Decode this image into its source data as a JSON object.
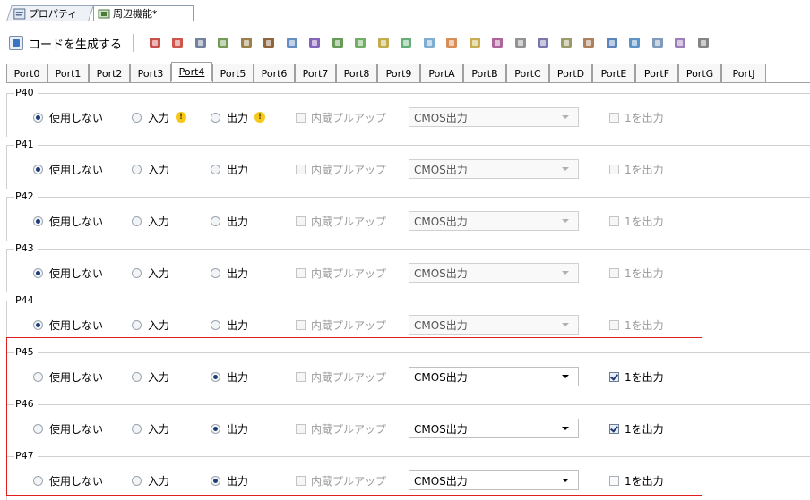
{
  "doc_tabs": [
    {
      "label": "プロパティ",
      "icon": "properties-icon"
    },
    {
      "label": "周辺機能*",
      "icon": "peripheral-icon"
    }
  ],
  "toolbar": {
    "generate_label": "コードを生成する",
    "icons": [
      "clock-gen-icon",
      "reset-icon",
      "ocd-icon",
      "voltage-icon",
      "flash-icon",
      "chip-icon",
      "watchdog-icon",
      "lvd-icon",
      "port-icon",
      "interrupt-icon",
      "timer-icon",
      "timer2-icon",
      "timer3-icon",
      "timer4-icon",
      "rtc-icon",
      "wdt-icon",
      "clock-out-icon",
      "pcl-icon",
      "serial-icon",
      "serial2-icon",
      "iic-icon",
      "iica-icon",
      "adc-icon",
      "dma-icon",
      "more-icon"
    ],
    "icon_colors": [
      "#c0302a",
      "#c43a2e",
      "#5b6b8c",
      "#5d8a3a",
      "#8a6a2a",
      "#7b4a1a",
      "#4c7ab8",
      "#6f4ab0",
      "#4d8a3a",
      "#5aa04a",
      "#b89c30",
      "#4aa060",
      "#6aa0c8",
      "#d07a3a",
      "#c0a030",
      "#a04a8a",
      "#808080",
      "#6060a0",
      "#8a8a50",
      "#a06a40",
      "#3f6fb0",
      "#4080c0",
      "#6a8ab0",
      "#8a6ab0",
      "#707070"
    ]
  },
  "port_tabs": [
    "Port0",
    "Port1",
    "Port2",
    "Port3",
    "Port4",
    "Port5",
    "Port6",
    "Port7",
    "Port8",
    "Port9",
    "PortA",
    "PortB",
    "PortC",
    "PortD",
    "PortE",
    "PortF",
    "PortG",
    "PortJ"
  ],
  "active_port": "Port4",
  "labels": {
    "unused": "使用しない",
    "input": "入力",
    "output": "出力",
    "pullup": "内蔵プルアップ",
    "high_out": "1を出力"
  },
  "groups": [
    {
      "name": "P40",
      "mode": "unused",
      "select": "CMOS出力",
      "high": false,
      "warn": true
    },
    {
      "name": "P41",
      "mode": "unused",
      "select": "CMOS出力",
      "high": false,
      "warn": false
    },
    {
      "name": "P42",
      "mode": "unused",
      "select": "CMOS出力",
      "high": false,
      "warn": false
    },
    {
      "name": "P43",
      "mode": "unused",
      "select": "CMOS出力",
      "high": false,
      "warn": false
    },
    {
      "name": "P44",
      "mode": "unused",
      "select": "CMOS出力",
      "high": false,
      "warn": false
    },
    {
      "name": "P45",
      "mode": "output",
      "select": "CMOS出力",
      "high": true,
      "warn": false
    },
    {
      "name": "P46",
      "mode": "output",
      "select": "CMOS出力",
      "high": true,
      "warn": false
    },
    {
      "name": "P47",
      "mode": "output",
      "select": "CMOS出力",
      "high": false,
      "warn": false
    }
  ],
  "colors": {
    "highlight": "#e02020",
    "radio_dot": "#1e3c78",
    "warning": "#f6c81a"
  }
}
